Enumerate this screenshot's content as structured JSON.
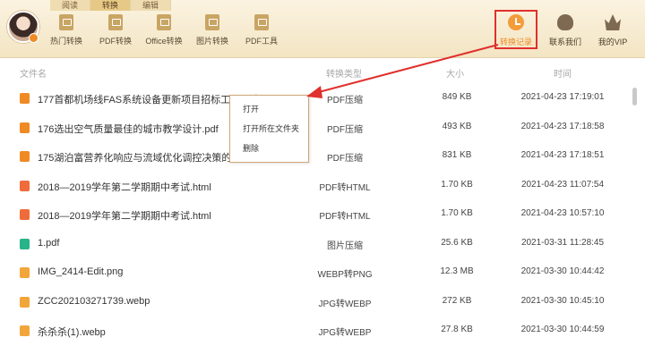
{
  "tabs": [
    "阅读",
    "转换",
    "编辑"
  ],
  "toolbar": {
    "items": [
      "热门转换",
      "PDF转换",
      "Office转换",
      "图片转换",
      "PDF工具"
    ],
    "right": {
      "history": "转换记录",
      "contact": "联系我们",
      "vip": "我的VIP"
    }
  },
  "columns": {
    "name": "文件名",
    "type": "转换类型",
    "size": "大小",
    "time": "时间"
  },
  "rows": [
    {
      "name": "177首都机场线FAS系统设备更新项目招标工程量清",
      "type": "PDF压缩",
      "size": "849 KB",
      "time": "2021-04-23 17:19:01",
      "icon": "pdf-icon"
    },
    {
      "name": "176选出空气质量最佳的城市教学设计.pdf",
      "type": "PDF压缩",
      "size": "493 KB",
      "time": "2021-04-23 17:18:58",
      "icon": "pdf-icon"
    },
    {
      "name": "175湖泊富营养化响应与流域优化调控决策的模型研",
      "type": "PDF压缩",
      "size": "831 KB",
      "time": "2021-04-23 17:18:51",
      "icon": "pdf-icon"
    },
    {
      "name": "2018—2019学年第二学期期中考试.html",
      "type": "PDF转HTML",
      "size": "1.70 KB",
      "time": "2021-04-23 11:07:54",
      "icon": "html-icon"
    },
    {
      "name": "2018—2019学年第二学期期中考试.html",
      "type": "PDF转HTML",
      "size": "1.70 KB",
      "time": "2021-04-23 10:57:10",
      "icon": "html-icon"
    },
    {
      "name": "1.pdf",
      "type": "图片压缩",
      "size": "25.6 KB",
      "time": "2021-03-31 11:28:45",
      "icon": "image-icon"
    },
    {
      "name": "IMG_2414-Edit.png",
      "type": "WEBP转PNG",
      "size": "12.3 MB",
      "time": "2021-03-30 10:44:42",
      "icon": "webp-icon"
    },
    {
      "name": "ZCC202103271739.webp",
      "type": "JPG转WEBP",
      "size": "272 KB",
      "time": "2021-03-30 10:45:10",
      "icon": "webp-icon"
    },
    {
      "name": "杀杀杀(1).webp",
      "type": "JPG转WEBP",
      "size": "27.8 KB",
      "time": "2021-03-30 10:44:59",
      "icon": "webp-icon"
    }
  ],
  "context_menu": [
    "打开",
    "打开所在文件夹",
    "删除"
  ],
  "colors": {
    "accent": "#f08a24",
    "highlight_border": "#e0302c",
    "toolbar_bg": "#f3e5c3"
  }
}
